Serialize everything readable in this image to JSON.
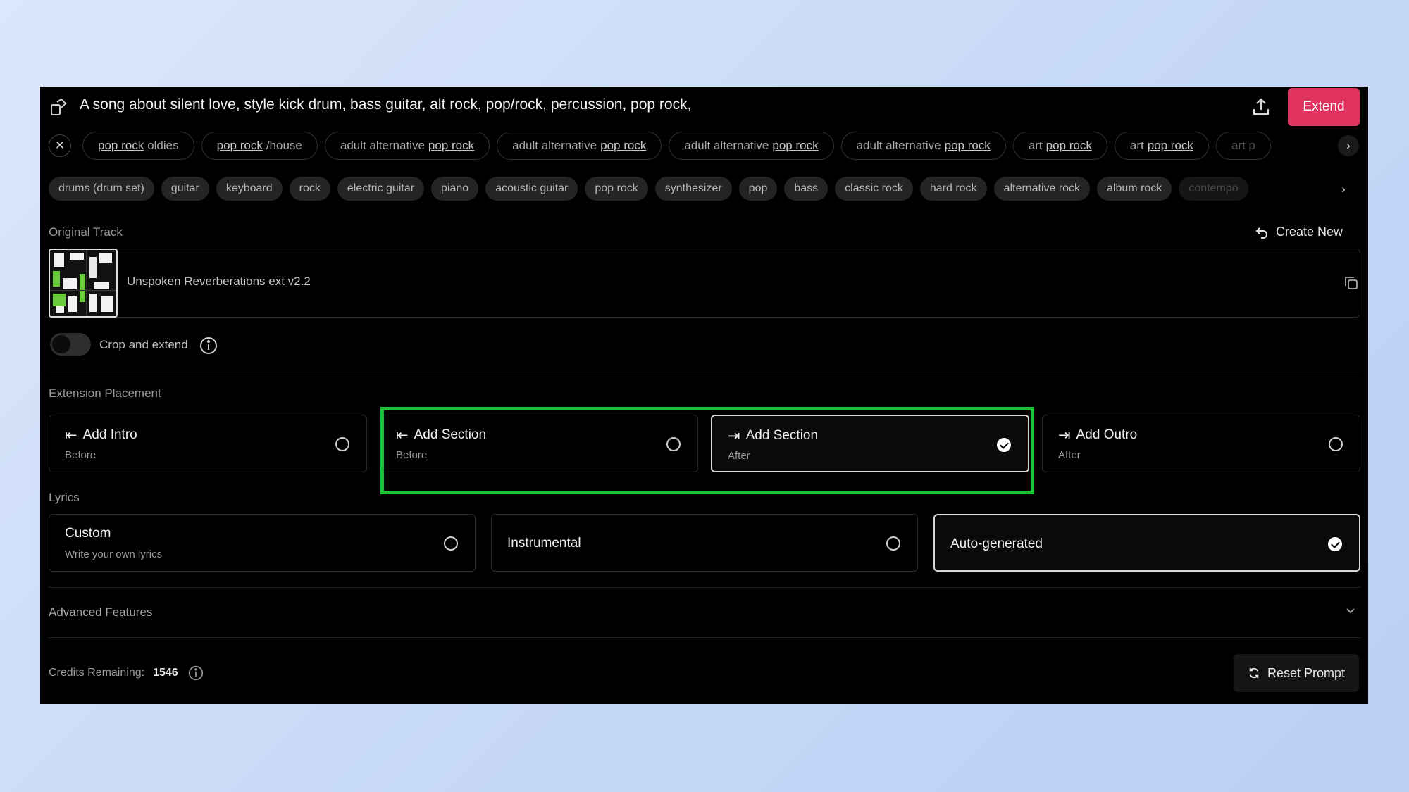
{
  "prompt": {
    "text": "A song about silent love, style kick drum, bass guitar, alt rock, pop/rock, percussion, pop rock,",
    "extend_label": "Extend"
  },
  "style_tags": [
    {
      "hl": "pop rock",
      "rest": "oldies",
      "hl_first": true
    },
    {
      "hl": "pop rock",
      "rest": "/house",
      "hl_first": true
    },
    {
      "hl": "pop rock",
      "rest": "adult alternative",
      "hl_first": false
    },
    {
      "hl": "pop rock",
      "rest": "adult alternative",
      "hl_first": false
    },
    {
      "hl": "pop rock",
      "rest": "adult alternative",
      "hl_first": false
    },
    {
      "hl": "pop rock",
      "rest": "adult alternative",
      "hl_first": false
    },
    {
      "hl": "pop rock",
      "rest": "art",
      "hl_first": false
    },
    {
      "hl": "pop rock",
      "rest": "art",
      "hl_first": false
    },
    {
      "hl": "",
      "rest": "art p",
      "hl_first": false
    }
  ],
  "instrument_tags": [
    "drums (drum set)",
    "guitar",
    "keyboard",
    "rock",
    "electric guitar",
    "piano",
    "acoustic guitar",
    "pop rock",
    "synthesizer",
    "pop",
    "bass",
    "classic rock",
    "hard rock",
    "alternative rock",
    "album rock",
    "contempo"
  ],
  "original_track": {
    "label": "Original Track",
    "create_new": "Create New",
    "name": "Unspoken Reverberations ext v2.2",
    "crop_label": "Crop and extend",
    "crop_enabled": false
  },
  "placement": {
    "label": "Extension Placement",
    "options": [
      {
        "title": "Add Intro",
        "sub": "Before",
        "selected": false,
        "glyph": "⇤"
      },
      {
        "title": "Add Section",
        "sub": "Before",
        "selected": false,
        "glyph": "⇤"
      },
      {
        "title": "Add Section",
        "sub": "After",
        "selected": true,
        "glyph": "⇥"
      },
      {
        "title": "Add Outro",
        "sub": "After",
        "selected": false,
        "glyph": "⇥"
      }
    ],
    "highlight_color": "#19c33b"
  },
  "lyrics": {
    "label": "Lyrics",
    "options": [
      {
        "title": "Custom",
        "sub": "Write your own lyrics",
        "selected": false
      },
      {
        "title": "Instrumental",
        "sub": "",
        "selected": false
      },
      {
        "title": "Auto-generated",
        "sub": "",
        "selected": true
      }
    ]
  },
  "advanced": {
    "label": "Advanced Features"
  },
  "credits": {
    "label": "Credits Remaining:",
    "value": "1546"
  },
  "reset_label": "Reset Prompt",
  "colors": {
    "accent": "#e0325f",
    "panel_bg": "#000000"
  }
}
